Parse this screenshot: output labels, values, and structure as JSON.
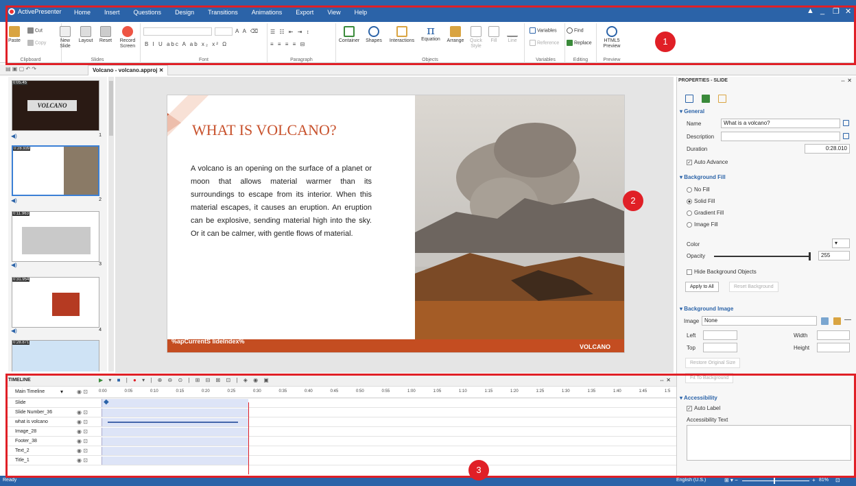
{
  "app": {
    "name": "ActivePresenter"
  },
  "menu_tabs": [
    "Home",
    "Insert",
    "Questions",
    "Design",
    "Transitions",
    "Animations",
    "Export",
    "View",
    "Help"
  ],
  "ribbon": {
    "clipboard": {
      "paste": "Paste",
      "cut": "Cut",
      "copy": "Copy",
      "label": "Clipboard"
    },
    "slides": {
      "new_slide": "New Slide",
      "layout": "Layout",
      "reset": "Reset",
      "record_screen": "Record Screen",
      "label": "Slides"
    },
    "font": {
      "label": "Font"
    },
    "paragraph": {
      "label": "Paragraph"
    },
    "objects": {
      "container": "Container",
      "shapes": "Shapes",
      "interactions": "Interactions",
      "equation": "Equation",
      "arrange": "Arrange",
      "quick_style": "Quick Style",
      "fill": "Fill",
      "line": "Line",
      "label": "Objects"
    },
    "variables": {
      "variables": "Variables",
      "reference": "Reference",
      "label": "Variables"
    },
    "editing": {
      "find": "Find",
      "replace": "Replace",
      "label": "Editing"
    },
    "preview": {
      "html5": "HTML5 Preview",
      "label": "Preview"
    }
  },
  "annotations": [
    "1",
    "2",
    "3"
  ],
  "document_tab": "Volcano - volcano.approj",
  "thumbnails": [
    {
      "duration": "0:05.45",
      "num": "1"
    },
    {
      "duration": "0:28.939",
      "num": "2"
    },
    {
      "duration": "0:11.963",
      "num": "3"
    },
    {
      "duration": "0:31.954",
      "num": "4"
    },
    {
      "duration": "0:28.871",
      "num": ""
    }
  ],
  "slide": {
    "title": "WHAT IS VOLCANO?",
    "body": "A volcano is an opening on the surface of a planet or moon that allows material warmer than its surroundings to escape from its interior. When this material escapes, it causes an eruption. An eruption can be explosive, sending material high into the sky. Or it can be calmer, with gentle flows of material.",
    "footer_left": "%apCurrentS lideIndex%",
    "footer_right": "VOLCANO"
  },
  "properties": {
    "header": "PROPERTIES - SLIDE",
    "general": "General",
    "name_label": "Name",
    "name_value": "What is a volcano?",
    "description_label": "Description",
    "duration_label": "Duration",
    "duration_value": "0:28.010",
    "auto_advance": "Auto Advance",
    "background_fill": "Background Fill",
    "no_fill": "No Fill",
    "solid_fill": "Solid Fill",
    "gradient_fill": "Gradient Fill",
    "image_fill": "Image Fill",
    "color_label": "Color",
    "opacity_label": "Opacity",
    "opacity_value": "255",
    "hide_bg_objects": "Hide Background Objects",
    "apply_all": "Apply to All",
    "reset_bg": "Reset Background",
    "background_image": "Background Image",
    "image_label": "Image",
    "image_value": "None",
    "left": "Left",
    "top": "Top",
    "width": "Width",
    "height": "Height",
    "restore_size": "Restore Original Size",
    "fit_bg": "Fit To Background",
    "accessibility": "Accessibility",
    "auto_label": "Auto Label",
    "accessibility_text": "Accessibility Text"
  },
  "timeline": {
    "title": "TIMELINE",
    "main": "Main Timeline",
    "ticks": [
      "0:00",
      "0:05",
      "0:10",
      "0:15",
      "0:20",
      "0:25",
      "0:30",
      "0:35",
      "0:40",
      "0:45",
      "0:50",
      "0:55",
      "1:00",
      "1:05",
      "1:10",
      "1:15",
      "1:20",
      "1:25",
      "1:30",
      "1:35",
      "1:40",
      "1:45",
      "1:5"
    ],
    "tracks": [
      "Slide",
      "Slide Number_36",
      "what is volcano",
      "Image_28",
      "Footer_38",
      "Text_2",
      "Title_1"
    ]
  },
  "status": {
    "left": "Ready",
    "language": "English (U.S.)",
    "zoom": "81%"
  }
}
